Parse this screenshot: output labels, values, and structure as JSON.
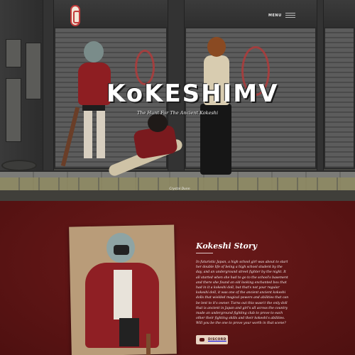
{
  "header": {
    "menu_label": "MENU"
  },
  "hero": {
    "title": "KoKESHIMV",
    "subtitle": "The Hunt For The Ancient Kokeshi",
    "signature": "Crystal Dunn"
  },
  "story": {
    "title": "Kokeshi Story",
    "body": "In futuristic Japan, a high school girl was about to start her double life of being a high school student by the day, and an underground street fighter by the night. It all started when she had to go to the school's basement and there she found an old looking enchanted box that had in it a kokeshi doll, but that's not your regular kokeshi doll, it was one of the ancient ancient kokeshi dolls that wielded magical powers and abilities that can be lent to it's owner. Turns out this wasn't the only doll that is ancient in Japan and girl's all across the country made an underground fighting club to prove to each other their fighting skills and their kokeshi's abilities. Will you be the one to prove your worth in that scene?",
    "discord_label": "DISCORD"
  },
  "colors": {
    "accent": "#c23b3b",
    "section_bg": "#5a1414",
    "button_bg": "#e9d3c3"
  }
}
